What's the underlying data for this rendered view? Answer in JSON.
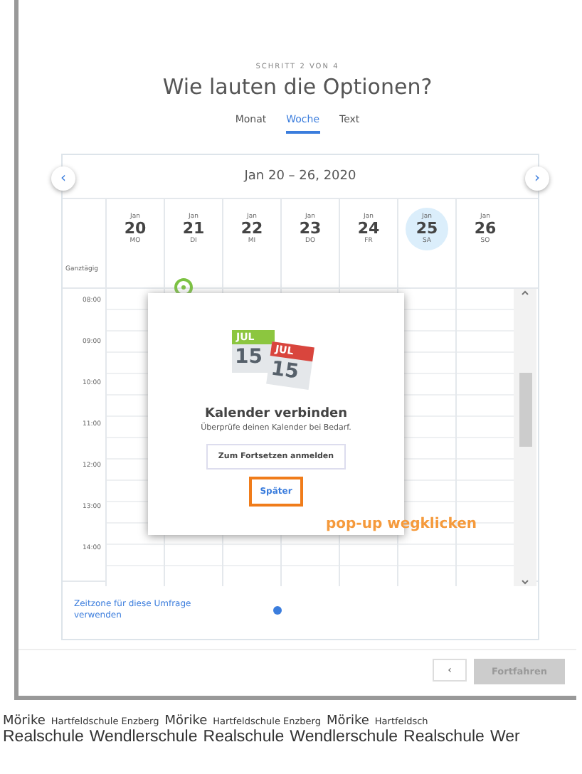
{
  "step": "SCHRITT 2 VON 4",
  "title": "Wie lauten die Optionen?",
  "tabs": [
    {
      "label": "Monat",
      "selected": false
    },
    {
      "label": "Woche",
      "selected": true
    },
    {
      "label": "Text",
      "selected": false
    }
  ],
  "calendar": {
    "prev": "‹",
    "next": "›",
    "range": "Jan 20 – 26, 2020",
    "all_day_label": "Ganztägig",
    "days": [
      {
        "month": "Jan",
        "date": "20",
        "weekday": "MO",
        "selected": false
      },
      {
        "month": "Jan",
        "date": "21",
        "weekday": "DI",
        "selected": false
      },
      {
        "month": "Jan",
        "date": "22",
        "weekday": "MI",
        "selected": false
      },
      {
        "month": "Jan",
        "date": "23",
        "weekday": "DO",
        "selected": false
      },
      {
        "month": "Jan",
        "date": "24",
        "weekday": "FR",
        "selected": false
      },
      {
        "month": "Jan",
        "date": "25",
        "weekday": "SA",
        "selected": true
      },
      {
        "month": "Jan",
        "date": "26",
        "weekday": "SO",
        "selected": false
      }
    ],
    "times": [
      "08:00",
      "09:00",
      "10:00",
      "11:00",
      "12:00",
      "13:00",
      "14:00"
    ],
    "timezone_link": "Zeitzone für diese Umfrage verwenden"
  },
  "dialog": {
    "calendar_icons": [
      {
        "month": "JUL",
        "day": "15",
        "color": "#8cc63f"
      },
      {
        "month": "JUL",
        "day": "15",
        "color": "#d9453d"
      }
    ],
    "title": "Kalender verbinden",
    "text": "Überprüfe deinen Kalender bei Bedarf.",
    "login_button": "Zum Fortsetzen anmelden",
    "later_button": "Später"
  },
  "annotation": "pop-up wegklicken",
  "footer": {
    "back": "‹",
    "continue": "Fortfahren",
    "continue_disabled": true
  },
  "banner": {
    "top": [
      "Mörike",
      "Hartfeldschule Enzberg",
      "Mörike",
      "Hartfeldschule Enzberg",
      "Mörike",
      "Hartfeldsch"
    ],
    "bottom": [
      "Realschule",
      "Wendlerschule",
      "Realschule",
      "Wendlerschule",
      "Realschule",
      "Wer"
    ]
  }
}
